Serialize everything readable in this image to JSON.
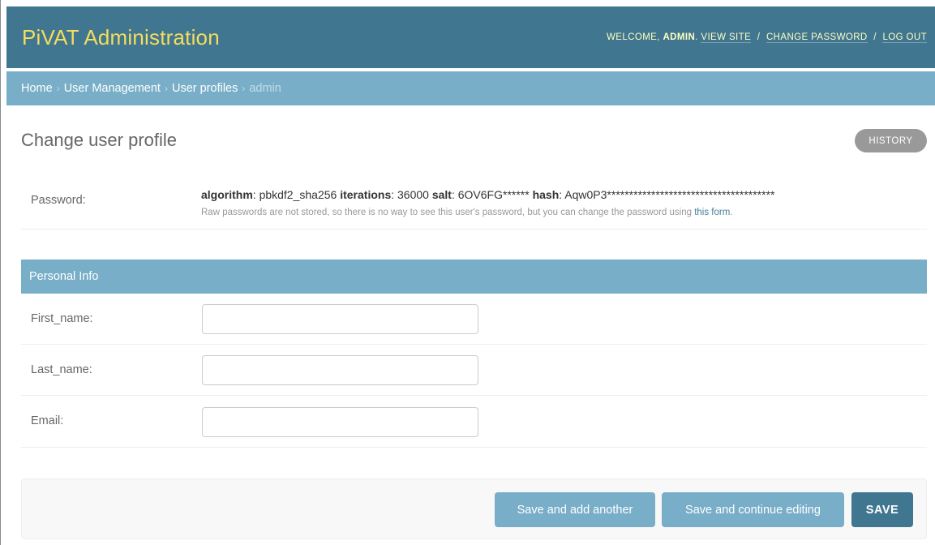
{
  "header": {
    "site_name": "PiVAT Administration",
    "welcome_prefix": "WELCOME,",
    "username": "ADMIN",
    "welcome_suffix": ".",
    "view_site": "VIEW SITE",
    "change_password": "CHANGE PASSWORD",
    "log_out": "LOG OUT",
    "separator": "/"
  },
  "breadcrumbs": {
    "home": "Home",
    "user_management": "User Management",
    "user_profiles": "User profiles",
    "current": "admin",
    "separator": "›"
  },
  "page": {
    "title": "Change user profile",
    "history_button": "HISTORY"
  },
  "password": {
    "label": "Password:",
    "algorithm_label": "algorithm",
    "algorithm_value": "pbkdf2_sha256",
    "iterations_label": "iterations",
    "iterations_value": "36000",
    "salt_label": "salt",
    "salt_value": "6OV6FG******",
    "hash_label": "hash",
    "hash_value": "Aqw0P3**************************************",
    "help_text": "Raw passwords are not stored, so there is no way to see this user's password, but you can change the password using",
    "help_link": "this form",
    "help_end": "."
  },
  "personal_info": {
    "caption": "Personal Info",
    "fields": [
      {
        "label": "First_name:",
        "value": ""
      },
      {
        "label": "Last_name:",
        "value": ""
      },
      {
        "label": "Email:",
        "value": ""
      }
    ]
  },
  "submit": {
    "save_add_another": "Save and add another",
    "save_continue": "Save and continue editing",
    "save": "SAVE"
  },
  "colors": {
    "header_bg": "#417690",
    "brand_text": "#f5dd5d",
    "breadcrumb_bg": "#79aec8",
    "link": "#447e9b",
    "history_bg": "#999999"
  }
}
